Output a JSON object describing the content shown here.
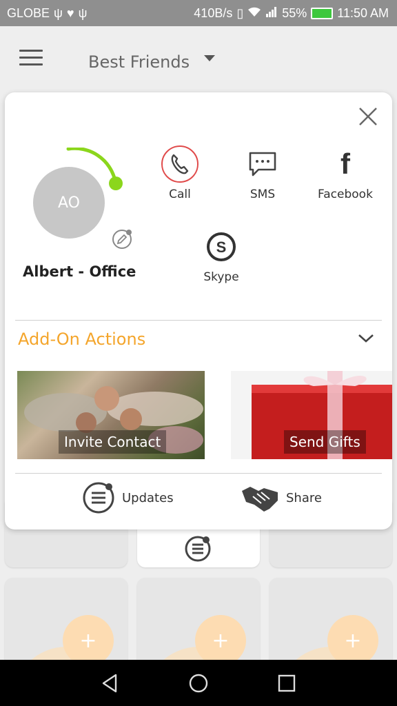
{
  "status_bar": {
    "carrier": "GLOBE",
    "net_speed": "410B/s",
    "battery_percent": "55%",
    "time": "11:50 AM"
  },
  "app_bar": {
    "group_title": "Best Friends"
  },
  "contact_card": {
    "avatar_initials": "AO",
    "name": "Albert - Office",
    "actions": {
      "call": "Call",
      "sms": "SMS",
      "facebook": "Facebook",
      "skype": "Skype"
    },
    "addon_title": "Add-On Actions",
    "addons": {
      "invite": "Invite Contact",
      "gifts": "Send Gifts"
    },
    "bottom": {
      "updates": "Updates",
      "share": "Share"
    }
  },
  "grid": {
    "plus_symbol": "+"
  },
  "colors": {
    "accent_orange": "#f4a52b",
    "progress_green": "#8bd61c",
    "call_red": "#e04a4a",
    "avatar_gray": "#c7c7c7"
  }
}
